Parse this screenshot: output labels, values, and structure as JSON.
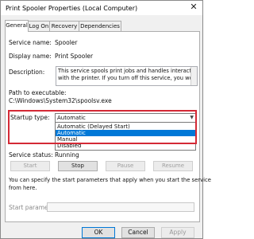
{
  "window": {
    "title": "Print Spooler Properties (Local Computer)"
  },
  "tabs": [
    {
      "label": "General"
    },
    {
      "label": "Log On"
    },
    {
      "label": "Recovery"
    },
    {
      "label": "Dependencies"
    }
  ],
  "general": {
    "service_name_label": "Service name:",
    "service_name_value": "Spooler",
    "display_name_label": "Display name:",
    "display_name_value": "Print Spooler",
    "description_label": "Description:",
    "description_line1": "This service spools print jobs and handles interaction",
    "description_line2": "with the printer.  If you turn off this service, you won't",
    "path_label": "Path to executable:",
    "path_value": "C:\\Windows\\System32\\spoolsv.exe",
    "startup_type_label": "Startup type:",
    "startup_type_value": "Automatic",
    "startup_options": [
      "Automatic (Delayed Start)",
      "Automatic",
      "Manual",
      "Disabled"
    ],
    "highlighted_option_index": 1,
    "service_status_label": "Service status:",
    "service_status_value": "Running",
    "buttons": {
      "start": "Start",
      "stop": "Stop",
      "pause": "Pause",
      "resume": "Resume"
    },
    "params_note_line1": "You can specify the start parameters that apply when you start the service",
    "params_note_line2": "from here.",
    "start_parameters_label": "Start parameters"
  },
  "footer": {
    "ok": "OK",
    "cancel": "Cancel",
    "apply": "Apply"
  },
  "colors": {
    "selection": "#0078d7",
    "highlight_box": "#d42a36"
  }
}
